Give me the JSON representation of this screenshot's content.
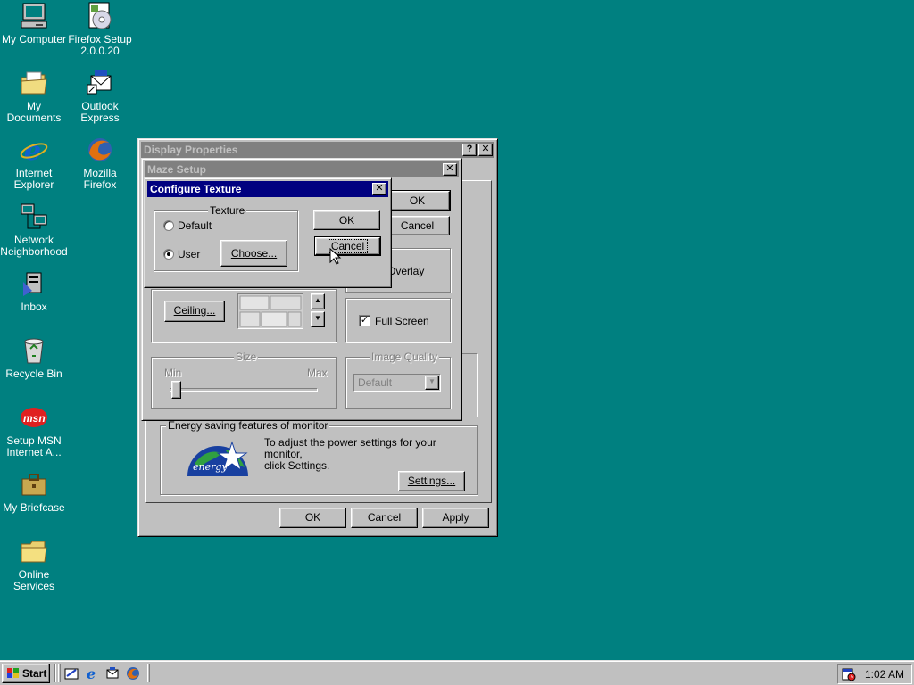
{
  "desktop": {
    "icons": [
      {
        "label": "My Computer"
      },
      {
        "label": "Firefox Setup\n2.0.0.20"
      },
      {
        "label": "My Documents"
      },
      {
        "label": "Outlook\nExpress"
      },
      {
        "label": "Internet\nExplorer"
      },
      {
        "label": "Mozilla Firefox"
      },
      {
        "label": "Network\nNeighborhood"
      },
      {
        "label": "Inbox"
      },
      {
        "label": "Recycle Bin"
      },
      {
        "label": "Setup MSN\nInternet A..."
      },
      {
        "label": "My Briefcase"
      },
      {
        "label": "Online\nServices"
      }
    ]
  },
  "display_properties": {
    "title": "Display Properties",
    "energy_group": "Energy saving features of monitor",
    "energy_text": "To adjust the power settings for your monitor,\nclick Settings.",
    "energy_logo_text": "energy",
    "settings_button": "Settings...",
    "ok": "OK",
    "cancel": "Cancel",
    "apply": "Apply"
  },
  "maze_setup": {
    "title": "Maze Setup",
    "ok": "OK",
    "cancel": "Cancel",
    "overlay_partial": "e Overlay",
    "ceiling_button": "Ceiling...",
    "full_screen_label": "Full Screen",
    "full_screen_checked": true,
    "size_group": "Size",
    "size_min": "Min",
    "size_max": "Max",
    "size_value": 0,
    "image_quality_group": "Image Quality",
    "image_quality_value": "Default"
  },
  "configure_texture": {
    "title": "Configure Texture",
    "group_label": "Texture",
    "option_default": "Default",
    "option_user": "User",
    "selected": "User",
    "choose_button": "Choose...",
    "ok": "OK",
    "cancel": "Cancel"
  },
  "taskbar": {
    "start_label": "Start",
    "clock": "1:02 AM"
  },
  "colors": {
    "desktop": "#008080",
    "face": "#c0c0c0",
    "active_title": "#000080",
    "inactive_title": "#808080"
  }
}
